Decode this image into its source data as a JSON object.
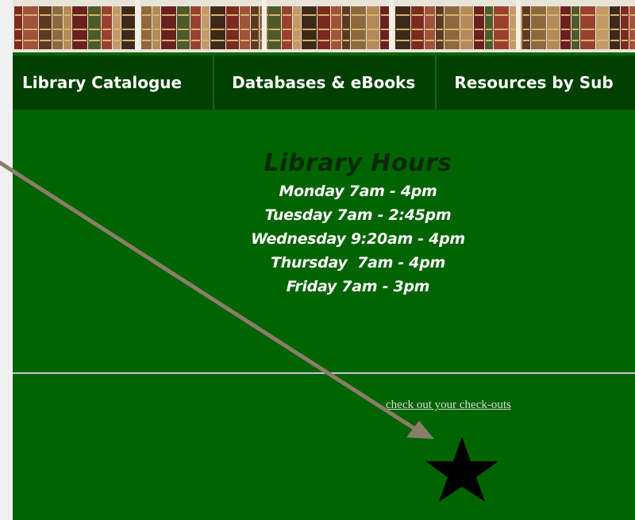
{
  "nav": {
    "items": [
      {
        "label": "Library Catalogue"
      },
      {
        "label": "Databases & eBooks"
      },
      {
        "label": "Resources by Sub"
      }
    ]
  },
  "hours": {
    "title": "Library Hours",
    "lines": [
      "Monday 7am - 4pm",
      "Tuesday 7am - 2:45pm",
      "Wednesday 9:20am - 4pm",
      "Thursday  7am - 4pm",
      "Friday 7am - 3pm"
    ]
  },
  "checkout_link": {
    "label": "check out your check-outs"
  },
  "icons": {
    "banner": "bookshelf-banner-image",
    "star": "star-icon",
    "annotation": "arrow-annotation"
  },
  "colors": {
    "page_background": "#006400",
    "nav_background": "#024002",
    "hours_title": "#0b2a0b",
    "arrow": "#8b7d6b"
  }
}
